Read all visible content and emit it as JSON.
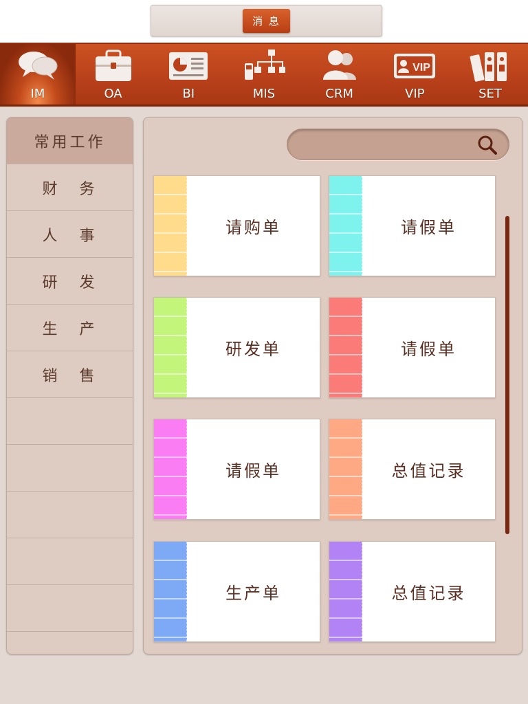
{
  "top": {
    "message_label": "消 息"
  },
  "nav": {
    "items": [
      {
        "label": "IM",
        "icon": "chat-bubbles-icon",
        "active": true
      },
      {
        "label": "OA",
        "icon": "briefcase-icon"
      },
      {
        "label": "BI",
        "icon": "report-icon"
      },
      {
        "label": "MIS",
        "icon": "org-chart-icon"
      },
      {
        "label": "CRM",
        "icon": "people-icon"
      },
      {
        "label": "VIP",
        "icon": "vip-card-icon"
      },
      {
        "label": "SET",
        "icon": "binders-icon"
      }
    ]
  },
  "sidebar": {
    "title": "常用工作",
    "items": [
      {
        "a": "财",
        "b": "务"
      },
      {
        "a": "人",
        "b": "事"
      },
      {
        "a": "研",
        "b": "发"
      },
      {
        "a": "生",
        "b": "产"
      },
      {
        "a": "销",
        "b": "售"
      }
    ]
  },
  "search": {
    "placeholder": ""
  },
  "cards": [
    {
      "label": "请购单",
      "color": "#ffdc8c"
    },
    {
      "label": "请假单",
      "color": "#7ef3ee"
    },
    {
      "label": "研发单",
      "color": "#c2f57a"
    },
    {
      "label": "请假单",
      "color": "#fb7b78"
    },
    {
      "label": "请假单",
      "color": "#fb7df4"
    },
    {
      "label": "总值记录",
      "color": "#ffa884"
    },
    {
      "label": "生产单",
      "color": "#7eaaf5"
    },
    {
      "label": "总值记录",
      "color": "#b183f5"
    }
  ],
  "colors": {
    "accent": "#c24a1c",
    "panel": "#decbc1",
    "text": "#5a2f22"
  }
}
